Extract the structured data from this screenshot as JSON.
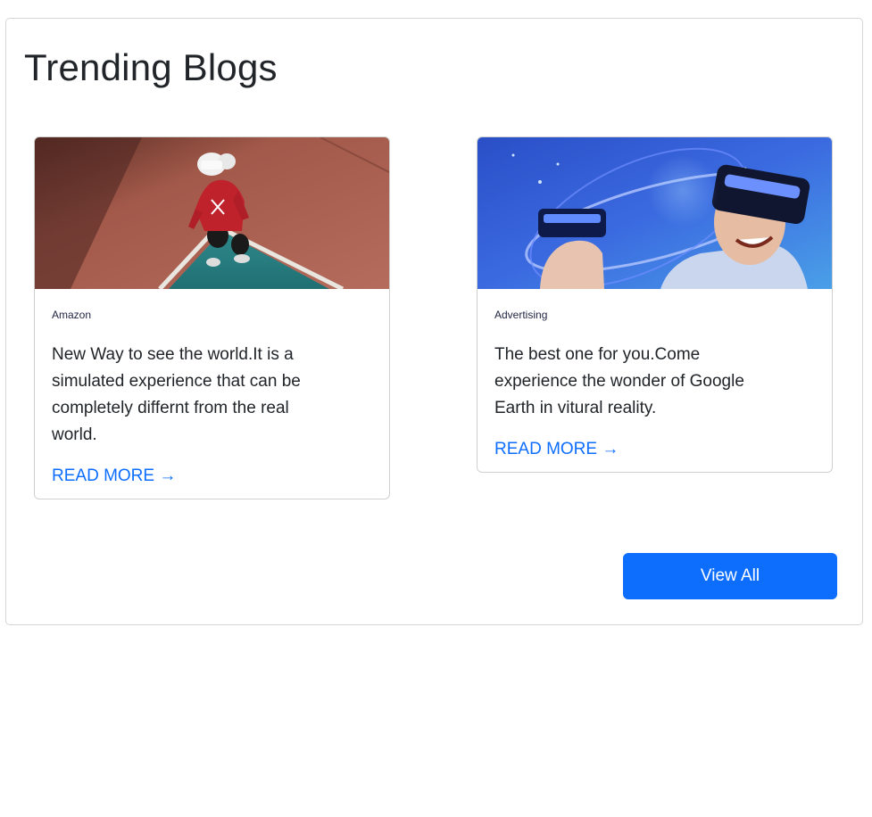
{
  "section": {
    "title": "Trending Blogs",
    "view_all_label": "View All"
  },
  "cards": [
    {
      "category": "Amazon",
      "text": "New Way to see the world.It is a simulated experience that can be completely differnt from the real world.",
      "link_label": "READ MORE →",
      "image": "vr-person-on-court-photo"
    },
    {
      "category": "Advertising",
      "text": "The best one for you.Come experience the wonder of Google Earth in vitural reality.",
      "link_label": "READ MORE →",
      "image": "vr-headset-people-photo"
    }
  ],
  "colors": {
    "accent": "#0d6efd",
    "text": "#212529",
    "border": "#d6d6d6"
  }
}
